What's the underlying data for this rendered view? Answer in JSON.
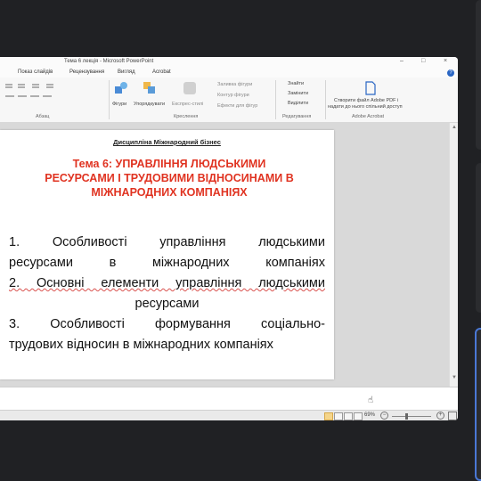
{
  "window": {
    "title": "Тема 6 лекція - Microsoft PowerPoint",
    "controls": [
      "–",
      "□",
      "×"
    ]
  },
  "menu": {
    "tabs": [
      "Показ слайдів",
      "Рецензування",
      "Вигляд",
      "Acrobat"
    ]
  },
  "ribbon": {
    "shapes_label": "Фігури",
    "arrange_label": "Упорядкувати",
    "quick_styles_label": "Експрес-стилі",
    "shape_fill": "Заливка фігури",
    "shape_outline": "Контур фігури",
    "shape_effects": "Ефекти для фігур",
    "find": "Знайти",
    "replace": "Замінити",
    "select": "Виділити",
    "acrobat_create": "Створити файл Adobe PDF і",
    "acrobat_create2": "надати до нього спільний доступ",
    "groups": {
      "paragraph": "Абзац",
      "drawing": "Креслення",
      "editing": "Редагування",
      "adobe": "Adobe Acrobat"
    }
  },
  "slide": {
    "discipline": "Дисципліна Міжнародний бізнес",
    "topic_line1": "Тема 6: УПРАВЛІННЯ ЛЮДСЬКИМИ",
    "topic_line2": "РЕСУРСАМИ І ТРУДОВИМИ ВІДНОСИНАМИ В",
    "topic_line3": "МІЖНАРОДНИХ КОМПАНІЯХ",
    "item1_line1": "1. Особливості управління людськими",
    "item1_line2": "ресурсами в міжнародних компаніях",
    "item2_line1": "2. Основні елементи управління людськими",
    "item2_line2": "ресурсами",
    "item3_line1": "3. Особливості формування соціально-",
    "item3_line2": "трудових відносин в міжнародних компаніях"
  },
  "status": {
    "zoom": "69%",
    "zoom_minus": "−",
    "zoom_plus": "+"
  },
  "colors": {
    "topic_red": "#e03321",
    "background": "#202124",
    "active_tile_border": "#4a78d6"
  }
}
